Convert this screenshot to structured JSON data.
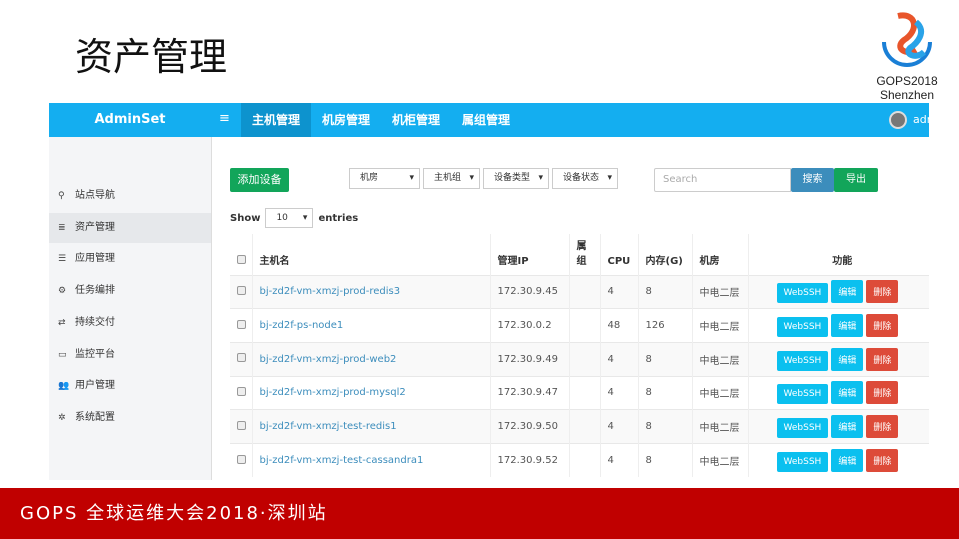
{
  "slide": {
    "title": "资产管理",
    "logo_line1": "GOPS2018",
    "logo_line2": "Shenzhen",
    "footer": "GOPS 全球运维大会2018·深圳站"
  },
  "topbar": {
    "brand": "AdminSet",
    "menu_icon": "≡",
    "nav": [
      "主机管理",
      "机房管理",
      "机柜管理",
      "属组管理"
    ],
    "user": "admin"
  },
  "sidebar": {
    "items": [
      {
        "icon": "⚲",
        "label": "站点导航"
      },
      {
        "icon": "≣",
        "label": "资产管理"
      },
      {
        "icon": "☰",
        "label": "应用管理"
      },
      {
        "icon": "⚙",
        "label": "任务编排"
      },
      {
        "icon": "⇄",
        "label": "持续交付"
      },
      {
        "icon": "▭",
        "label": "监控平台"
      },
      {
        "icon": "👥",
        "label": "用户管理"
      },
      {
        "icon": "✲",
        "label": "系统配置"
      }
    ]
  },
  "toolbar": {
    "add": "添加设备",
    "filters": [
      "机房",
      "主机组",
      "设备类型",
      "设备状态"
    ],
    "search_placeholder": "Search",
    "search_btn": "搜索",
    "export_btn": "导出"
  },
  "length": {
    "show": "Show",
    "value": "10",
    "entries": "entries"
  },
  "table": {
    "headers": [
      "主机名",
      "管理IP",
      "属组",
      "CPU",
      "内存(G)",
      "机房",
      "功能"
    ],
    "actions": [
      "WebSSH",
      "编辑",
      "删除"
    ],
    "rows": [
      [
        "bj-zd2f-vm-xmzj-prod-redis3",
        "172.30.9.45",
        "",
        "4",
        "8",
        "中电二层"
      ],
      [
        "bj-zd2f-ps-node1",
        "172.30.0.2",
        "",
        "48",
        "126",
        "中电二层"
      ],
      [
        "bj-zd2f-vm-xmzj-prod-web2",
        "172.30.9.49",
        "",
        "4",
        "8",
        "中电二层"
      ],
      [
        "bj-zd2f-vm-xmzj-prod-mysql2",
        "172.30.9.47",
        "",
        "4",
        "8",
        "中电二层"
      ],
      [
        "bj-zd2f-vm-xmzj-test-redis1",
        "172.30.9.50",
        "",
        "4",
        "8",
        "中电二层"
      ],
      [
        "bj-zd2f-vm-xmzj-test-cassandra1",
        "172.30.9.52",
        "",
        "4",
        "8",
        "中电二层"
      ]
    ]
  }
}
